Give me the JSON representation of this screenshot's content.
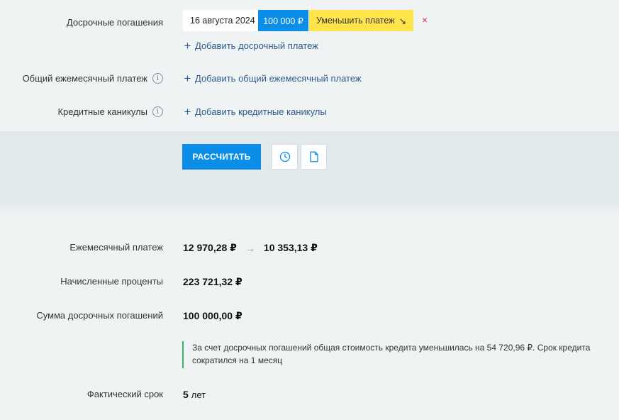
{
  "early_payments": {
    "label": "Досрочные погашения",
    "date": "16 августа 2024",
    "amount": "100 000 ₽",
    "mode": "Уменьшить платеж",
    "mode_arrow": "↘",
    "remove": "×",
    "add_link": "Добавить досрочный платеж"
  },
  "common_monthly": {
    "label": "Общий ежемесячный платеж",
    "info": "i",
    "add_link": "Добавить общий ежемесячный платеж"
  },
  "holidays": {
    "label": "Кредитные каникулы",
    "info": "i",
    "add_link": "Добавить кредитные каникулы"
  },
  "actions": {
    "calculate_label": "РАССЧИТАТЬ",
    "history_icon": "clock-icon",
    "document_icon": "document-icon"
  },
  "results": {
    "monthly_label": "Ежемесячный платеж",
    "monthly_before": "12 970,28 ₽",
    "monthly_arrow": "→",
    "monthly_after": "10 353,13 ₽",
    "interest_label": "Начисленные проценты",
    "interest_value": "223 721,32 ₽",
    "early_sum_label": "Сумма досрочных погашений",
    "early_sum_value": "100 000,00 ₽",
    "note_line1": "За счет досрочных погашений общая стоимость кредита уменьшилась на 54 720,96 ₽. Срок кредита",
    "note_line2": "сократился на 1 месяц",
    "term_label": "Фактический срок",
    "term_value": "5",
    "term_unit": "лет"
  },
  "colors": {
    "accent_blue": "#0a8ee8",
    "highlight_yellow": "#ffe54a",
    "link_blue": "#2d5a8f",
    "remove_red": "#d9354f",
    "note_green": "#3bb56b"
  }
}
